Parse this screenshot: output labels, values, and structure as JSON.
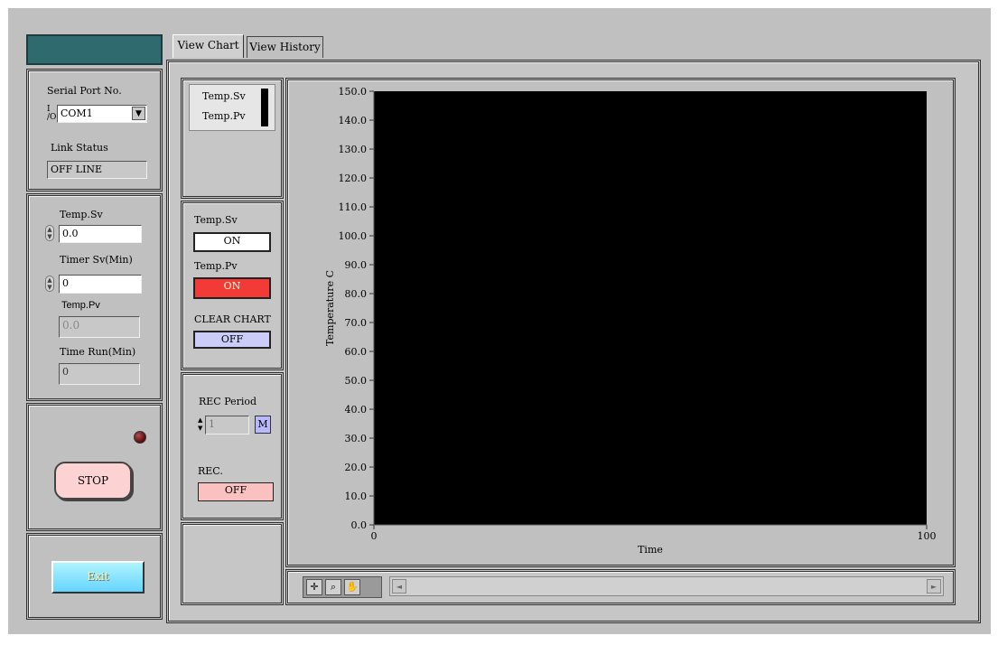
{
  "tabs": {
    "view_chart": "View Chart",
    "view_history": "View History"
  },
  "comm": {
    "serial_port_label": "Serial Port No.",
    "port_prefix": "I/O",
    "serial_port_value": "COM1",
    "link_status_label": "Link Status",
    "link_status_value": "OFF LINE"
  },
  "params": {
    "temp_sv_label": "Temp.Sv",
    "temp_sv_value": "0.0",
    "timer_sv_label": "Timer Sv(Min)",
    "timer_sv_value": "0",
    "temp_pv_label": "Temp.Pv",
    "temp_pv_value": "0.0",
    "time_run_label": "Time Run(Min)",
    "time_run_value": "0"
  },
  "control": {
    "stop_label": "STOP",
    "exit_label": "Exit",
    "led_color": "#7a1010"
  },
  "legend": {
    "items": [
      "Temp.Sv",
      "Temp.Pv"
    ]
  },
  "toggles": {
    "temp_sv_label": "Temp.Sv",
    "temp_sv_state": "ON",
    "temp_pv_label": "Temp.Pv",
    "temp_pv_state": "ON",
    "clear_chart_label": "CLEAR CHART",
    "clear_chart_state": "OFF"
  },
  "record": {
    "rec_period_label": "REC Period",
    "rec_period_value": "1",
    "rec_period_unit": "M",
    "rec_label": "REC.",
    "rec_state": "OFF"
  },
  "chart_data": {
    "type": "line",
    "title": "",
    "xlabel": "Time",
    "ylabel": "Temperature C",
    "xlim": [
      0,
      100
    ],
    "ylim": [
      0,
      150
    ],
    "y_ticks": [
      "0.0",
      "10.0",
      "20.0",
      "30.0",
      "40.0",
      "50.0",
      "60.0",
      "70.0",
      "80.0",
      "90.0",
      "100.0",
      "110.0",
      "120.0",
      "130.0",
      "140.0",
      "150.0"
    ],
    "x_ticks": [
      "0",
      "100"
    ],
    "series": [],
    "background": "#000000",
    "grid": false
  }
}
